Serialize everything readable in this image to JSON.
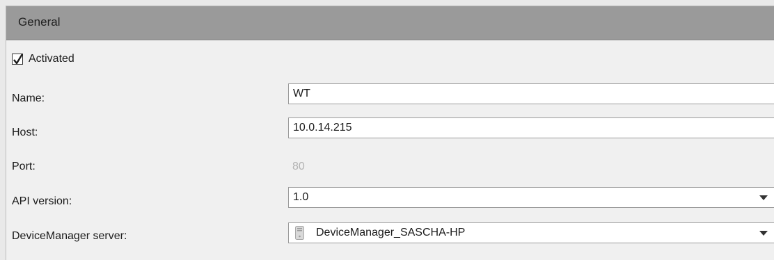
{
  "header": {
    "title": "General"
  },
  "activated": {
    "label": "Activated",
    "checked": true
  },
  "fields": {
    "name": {
      "label": "Name:",
      "value": "WT"
    },
    "host": {
      "label": "Host:",
      "value": "10.0.14.215"
    },
    "port": {
      "label": "Port:",
      "value": "80"
    },
    "api_version": {
      "label": "API version:",
      "value": "1.0"
    },
    "device_manager": {
      "label": "DeviceManager server:",
      "value": "DeviceManager_SASCHA-HP",
      "icon": "server-icon"
    }
  }
}
